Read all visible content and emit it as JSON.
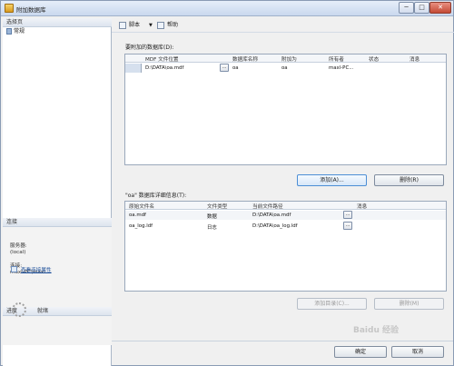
{
  "window": {
    "title": "附加数据库",
    "min": "─",
    "max": "□",
    "close": "✕"
  },
  "left": {
    "select_page": "选择页",
    "nav": [
      {
        "label": "常规"
      }
    ],
    "connection_head": "连接",
    "server_label": "服务器:",
    "server_value": "(local)",
    "conn_label": "连接:",
    "conn_value": "maxl-PC\\maxl",
    "view_props": "查看连接属性",
    "progress_head": "进度",
    "progress_status": "就绪"
  },
  "toolbar": {
    "script": "脚本",
    "help": "帮助"
  },
  "attach": {
    "label": "要附加的数据库(D):",
    "columns": [
      "MDF 文件位置",
      "数据库名称",
      "附加为",
      "所有者",
      "状态",
      "消息"
    ],
    "rows": [
      {
        "mdf": "D:\\DATA\\oa.mdf",
        "name": "oa",
        "attach_as": "oa",
        "owner": "maxl-PC...",
        "status": "",
        "message": ""
      }
    ],
    "add_button": "添加(A)...",
    "remove_button": "删除(R)"
  },
  "details": {
    "label": "\"oa\" 数据库详细信息(T):",
    "columns": [
      "原始文件名",
      "文件类型",
      "当前文件路径",
      "消息"
    ],
    "rows": [
      {
        "file": "oa.mdf",
        "type": "数据",
        "path": "D:\\DATA\\oa.mdf",
        "message": ""
      },
      {
        "file": "oa_log.ldf",
        "type": "日志",
        "path": "D:\\DATA\\oa_log.ldf",
        "message": ""
      }
    ],
    "add_catalog": "添加目录(C)...",
    "remove_button": "删除(M)"
  },
  "footer": {
    "ok": "确定",
    "cancel": "取消"
  },
  "watermark": "Baidu 经验",
  "ellipsis": "..."
}
